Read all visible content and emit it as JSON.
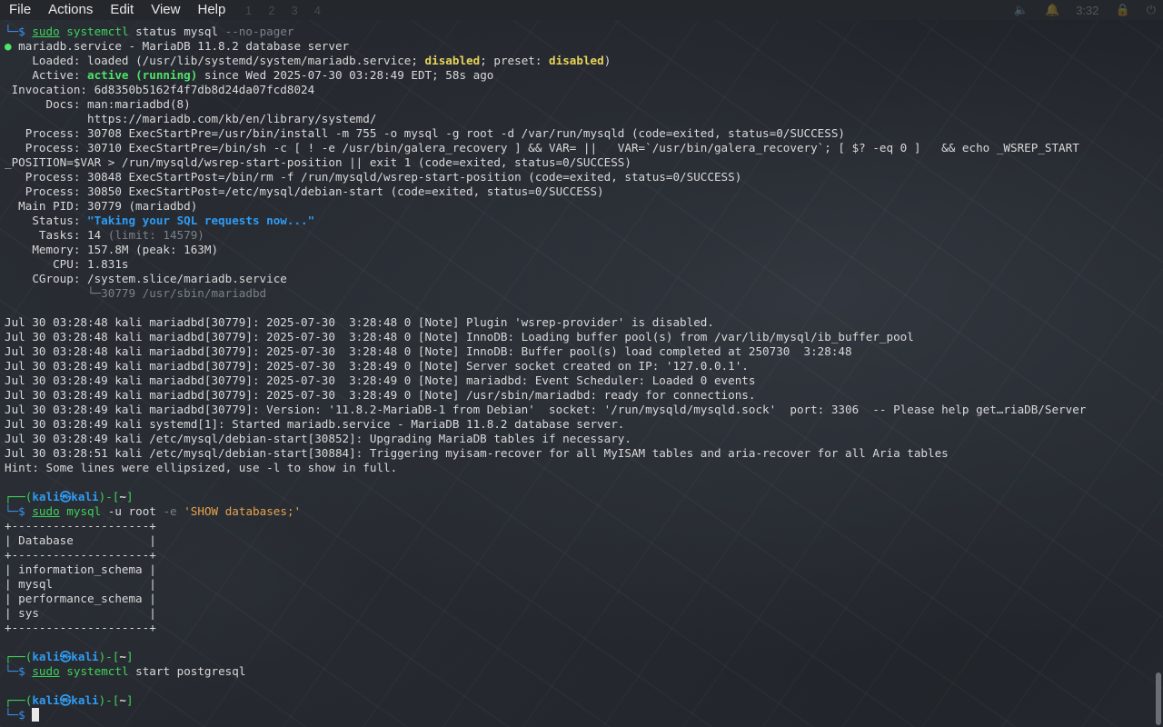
{
  "menubar": {
    "items": [
      "File",
      "Actions",
      "Edit",
      "View",
      "Help"
    ],
    "workspaces": [
      "1",
      "2",
      "3",
      "4"
    ],
    "clock": "3:32"
  },
  "terminal": {
    "cmd1_prompt_tail": "└─$ ",
    "cmd1": {
      "sudo": "sudo",
      "prog": "systemctl",
      "args": " status mysql ",
      "flag": "--no-pager"
    },
    "status": {
      "dot": "●",
      "header": " mariadb.service - MariaDB 11.8.2 database server",
      "loaded_label": "    Loaded: ",
      "loaded_pre": "loaded (/usr/lib/systemd/system/mariadb.service; ",
      "loaded_disabled": "disabled",
      "loaded_mid": "; preset: ",
      "loaded_preset": "disabled",
      "loaded_end": ")",
      "active_label": "    Active: ",
      "active_state": "active (running)",
      "active_since": " since Wed 2025-07-30 03:28:49 EDT; 58s ago",
      "invocation": " Invocation: 6d8350b5162f4f7db8d24da07fcd8024",
      "docs1": "      Docs: man:mariadbd(8)",
      "docs2": "            https://mariadb.com/kb/en/library/systemd/",
      "process1": "   Process: 30708 ExecStartPre=/usr/bin/install -m 755 -o mysql -g root -d /var/run/mysqld (code=exited, status=0/SUCCESS)",
      "process2a": "   Process: 30710 ExecStartPre=/bin/sh -c [ ! -e /usr/bin/galera_recovery ] && VAR= ||   VAR=`/usr/bin/galera_recovery`; [ $? -eq 0 ]   && echo _WSREP_START",
      "process2b": "_POSITION=$VAR > /run/mysqld/wsrep-start-position || exit 1 (code=exited, status=0/SUCCESS)",
      "process3": "   Process: 30848 ExecStartPost=/bin/rm -f /run/mysqld/wsrep-start-position (code=exited, status=0/SUCCESS)",
      "process4": "   Process: 30850 ExecStartPost=/etc/mysql/debian-start (code=exited, status=0/SUCCESS)",
      "mainpid": "  Main PID: 30779 (mariadbd)",
      "status_label": "    Status: ",
      "status_value": "\"Taking your SQL requests now...\"",
      "tasks_label": "     Tasks: 14 ",
      "tasks_limit": "(limit: 14579)",
      "memory": "    Memory: 157.8M (peak: 163M)",
      "cpu": "       CPU: 1.831s",
      "cgroup": "    CGroup: /system.slice/mariadb.service",
      "cgroup_child": "            └─30779 /usr/sbin/mariadbd"
    },
    "logs": [
      "Jul 30 03:28:48 kali mariadbd[30779]: 2025-07-30  3:28:48 0 [Note] Plugin 'wsrep-provider' is disabled.",
      "Jul 30 03:28:48 kali mariadbd[30779]: 2025-07-30  3:28:48 0 [Note] InnoDB: Loading buffer pool(s) from /var/lib/mysql/ib_buffer_pool",
      "Jul 30 03:28:48 kali mariadbd[30779]: 2025-07-30  3:28:48 0 [Note] InnoDB: Buffer pool(s) load completed at 250730  3:28:48",
      "Jul 30 03:28:49 kali mariadbd[30779]: 2025-07-30  3:28:49 0 [Note] Server socket created on IP: '127.0.0.1'.",
      "Jul 30 03:28:49 kali mariadbd[30779]: 2025-07-30  3:28:49 0 [Note] mariadbd: Event Scheduler: Loaded 0 events",
      "Jul 30 03:28:49 kali mariadbd[30779]: 2025-07-30  3:28:49 0 [Note] /usr/sbin/mariadbd: ready for connections.",
      "Jul 30 03:28:49 kali mariadbd[30779]: Version: '11.8.2-MariaDB-1 from Debian'  socket: '/run/mysqld/mysqld.sock'  port: 3306  -- Please help get…riaDB/Server",
      "Jul 30 03:28:49 kali systemd[1]: Started mariadb.service - MariaDB 11.8.2 database server.",
      "Jul 30 03:28:49 kali /etc/mysql/debian-start[30852]: Upgrading MariaDB tables if necessary.",
      "Jul 30 03:28:51 kali /etc/mysql/debian-start[30884]: Triggering myisam-recover for all MyISAM tables and aria-recover for all Aria tables",
      "Hint: Some lines were ellipsized, use -l to show in full."
    ],
    "prompt": {
      "open": "┌──(",
      "user": "kali",
      "at": "㉿",
      "host": "kali",
      "close": ")-[",
      "dir": "~",
      "end": "]",
      "line2": "└─$ "
    },
    "cmd2": {
      "sudo": "sudo",
      "prog": "mysql",
      "args": " -u root ",
      "flag": "-e",
      "space": " ",
      "str": "'SHOW databases;'"
    },
    "table": {
      "border": "+--------------------+",
      "header": "| Database           |",
      "rows": [
        "| information_schema |",
        "| mysql              |",
        "| performance_schema |",
        "| sys                |"
      ]
    },
    "cmd3": {
      "sudo": "sudo",
      "prog": "systemctl",
      "args": " start postgresql"
    }
  }
}
